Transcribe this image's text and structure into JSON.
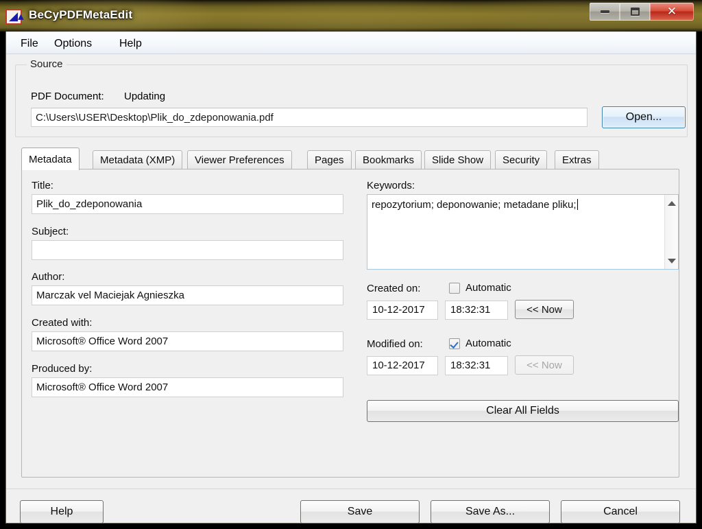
{
  "window": {
    "title": "BeCyPDFMetaEdit",
    "icon": "app-icon",
    "caption_buttons": {
      "minimize": "minimize-icon",
      "maximize": "restore-icon",
      "close": "close-icon"
    }
  },
  "menubar": {
    "items": [
      {
        "label": "File"
      },
      {
        "label": "Options"
      },
      {
        "label": "Help"
      }
    ]
  },
  "source": {
    "legend": "Source",
    "document_label": "PDF Document:",
    "document_status": "Updating",
    "path_value": "C:\\Users\\USER\\Desktop\\Plik_do_zdeponowania.pdf",
    "open_button": "Open..."
  },
  "tabs": [
    {
      "label": "Metadata",
      "active": true
    },
    {
      "label": "Metadata (XMP)",
      "active": false
    },
    {
      "label": "Viewer Preferences",
      "active": false
    },
    {
      "label": "Pages",
      "active": false
    },
    {
      "label": "Bookmarks",
      "active": false
    },
    {
      "label": "Slide Show",
      "active": false
    },
    {
      "label": "Security",
      "active": false
    },
    {
      "label": "Extras",
      "active": false
    }
  ],
  "metadata": {
    "title_label": "Title:",
    "title_value": "Plik_do_zdeponowania",
    "subject_label": "Subject:",
    "subject_value": "",
    "author_label": "Author:",
    "author_value": "Marczak vel Maciejak Agnieszka",
    "created_with_label": "Created with:",
    "created_with_value": "Microsoft® Office Word 2007",
    "produced_by_label": "Produced by:",
    "produced_by_value": "Microsoft® Office Word 2007",
    "keywords_label": "Keywords:",
    "keywords_value": "repozytorium; deponowanie; metadane pliku;",
    "created_on": {
      "label": "Created on:",
      "automatic_label": "Automatic",
      "automatic_checked": false,
      "date": "10-12-2017",
      "time": "18:32:31",
      "now_button": "<< Now",
      "now_enabled": true
    },
    "modified_on": {
      "label": "Modified on:",
      "automatic_label": "Automatic",
      "automatic_checked": true,
      "date": "10-12-2017",
      "time": "18:32:31",
      "now_button": "<< Now",
      "now_enabled": false
    },
    "clear_all_button": "Clear All Fields"
  },
  "footer": {
    "help_button": "Help",
    "save_button": "Save",
    "save_as_button": "Save As...",
    "cancel_button": "Cancel"
  },
  "colors": {
    "titlebar_glass": "#8a7a2c",
    "close_button": "#c0392b",
    "focus_border": "#3c7fb1",
    "checkbox_check": "#2a6fc9",
    "window_bg": "#f0f0f0"
  }
}
